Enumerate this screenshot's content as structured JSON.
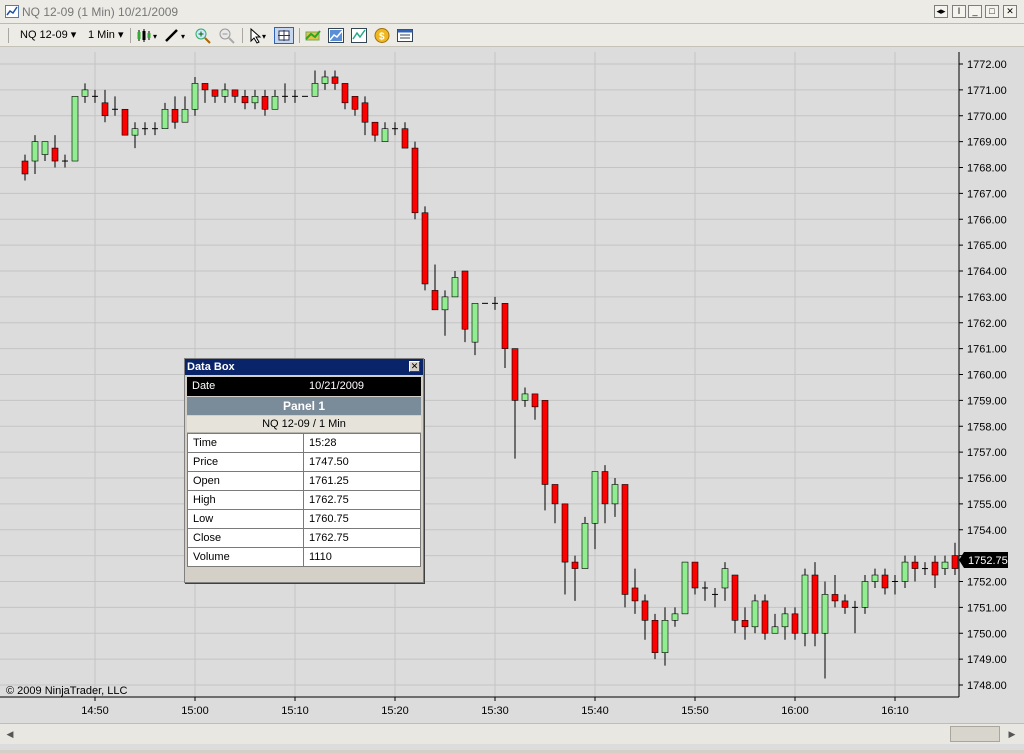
{
  "window": {
    "title": "NQ 12-09 (1 Min)  10/21/2009",
    "buttons": [
      "restore",
      "pin",
      "minimize",
      "maximize",
      "close"
    ]
  },
  "toolbar": {
    "instrument": "NQ 12-09",
    "interval": "1 Min",
    "icons": [
      "bar-type-icon",
      "drawing-tool-icon",
      "zoom-in-icon",
      "zoom-out-icon",
      "pointer-icon",
      "crosshair-icon",
      "chart-properties-icon",
      "indicator-icon",
      "strategy-icon",
      "order-icon",
      "data-box-icon"
    ]
  },
  "chart": {
    "copyright": "© 2009 NinjaTrader, LLC",
    "last_price_label": "1752.75",
    "colors": {
      "up": "#90ee90",
      "down": "#ff0000",
      "background": "#dcdcdc",
      "grid": "#c4c4c4"
    }
  },
  "chart_data": {
    "type": "candlestick",
    "title": "",
    "xlabel": "",
    "ylabel": "",
    "ylim": [
      1747.8,
      1772.4
    ],
    "x_ticks": [
      "14:50",
      "15:00",
      "15:10",
      "15:20",
      "15:30",
      "15:40",
      "15:50",
      "16:00",
      "16:10"
    ],
    "y_ticks": [
      "1772.00",
      "1771.00",
      "1770.00",
      "1769.00",
      "1768.00",
      "1767.00",
      "1766.00",
      "1765.00",
      "1764.00",
      "1763.00",
      "1762.00",
      "1761.00",
      "1760.00",
      "1759.00",
      "1758.00",
      "1757.00",
      "1756.00",
      "1755.00",
      "1754.00",
      "1753.00",
      "1752.00",
      "1751.00",
      "1750.00",
      "1749.00",
      "1748.00"
    ],
    "candles": [
      [
        "14:43",
        1768.25,
        1767.75,
        1768.5,
        1767.5
      ],
      [
        "14:44",
        1768.25,
        1769.0,
        1769.25,
        1767.75
      ],
      [
        "14:45",
        1768.5,
        1769.0,
        1769.0,
        1768.25
      ],
      [
        "14:46",
        1768.75,
        1768.25,
        1769.25,
        1768.0
      ],
      [
        "14:47",
        1768.25,
        1768.25,
        1768.5,
        1768.0
      ],
      [
        "14:48",
        1768.25,
        1770.75,
        1770.75,
        1768.25
      ],
      [
        "14:49",
        1770.75,
        1771.0,
        1771.25,
        1770.5
      ],
      [
        "14:50",
        1770.75,
        1770.75,
        1771.0,
        1770.5
      ],
      [
        "14:51",
        1770.5,
        1770.0,
        1771.0,
        1769.75
      ],
      [
        "14:52",
        1770.25,
        1770.25,
        1770.75,
        1770.0
      ],
      [
        "14:53",
        1770.25,
        1769.25,
        1770.25,
        1769.25
      ],
      [
        "14:54",
        1769.25,
        1769.5,
        1769.75,
        1768.75
      ],
      [
        "14:55",
        1769.5,
        1769.5,
        1769.75,
        1769.25
      ],
      [
        "14:56",
        1769.5,
        1769.5,
        1769.75,
        1769.25
      ],
      [
        "14:57",
        1769.5,
        1770.25,
        1770.5,
        1769.5
      ],
      [
        "14:58",
        1770.25,
        1769.75,
        1770.75,
        1769.5
      ],
      [
        "14:59",
        1769.75,
        1770.25,
        1770.75,
        1769.75
      ],
      [
        "15:00",
        1770.25,
        1771.25,
        1771.5,
        1770.0
      ],
      [
        "15:01",
        1771.25,
        1771.0,
        1771.25,
        1770.5
      ],
      [
        "15:02",
        1771.0,
        1770.75,
        1771.0,
        1770.5
      ],
      [
        "15:03",
        1770.75,
        1771.0,
        1771.25,
        1770.5
      ],
      [
        "15:04",
        1771.0,
        1770.75,
        1771.0,
        1770.5
      ],
      [
        "15:05",
        1770.75,
        1770.5,
        1771.0,
        1770.25
      ],
      [
        "15:06",
        1770.5,
        1770.75,
        1771.0,
        1770.25
      ],
      [
        "15:07",
        1770.75,
        1770.25,
        1771.0,
        1770.0
      ],
      [
        "15:08",
        1770.25,
        1770.75,
        1771.0,
        1770.25
      ],
      [
        "15:09",
        1770.75,
        1770.75,
        1771.25,
        1770.5
      ],
      [
        "15:10",
        1770.75,
        1770.75,
        1771.0,
        1770.5
      ],
      [
        "15:11",
        1770.75,
        1770.75,
        1770.75,
        1770.75
      ],
      [
        "15:12",
        1770.75,
        1771.25,
        1771.75,
        1770.75
      ],
      [
        "15:13",
        1771.25,
        1771.5,
        1771.75,
        1771.0
      ],
      [
        "15:14",
        1771.5,
        1771.25,
        1771.75,
        1771.0
      ],
      [
        "15:15",
        1771.25,
        1770.5,
        1771.25,
        1770.25
      ],
      [
        "15:16",
        1770.75,
        1770.25,
        1770.75,
        1770.0
      ],
      [
        "15:17",
        1770.5,
        1769.75,
        1770.75,
        1769.25
      ],
      [
        "15:18",
        1769.75,
        1769.25,
        1769.75,
        1769.0
      ],
      [
        "15:19",
        1769.0,
        1769.5,
        1769.75,
        1769.0
      ],
      [
        "15:20",
        1769.5,
        1769.5,
        1769.75,
        1769.25
      ],
      [
        "15:21",
        1769.5,
        1768.75,
        1769.75,
        1768.75
      ],
      [
        "15:22",
        1768.75,
        1766.25,
        1769.0,
        1766.0
      ],
      [
        "15:23",
        1766.25,
        1763.5,
        1766.5,
        1763.25
      ],
      [
        "15:24",
        1763.25,
        1762.5,
        1764.25,
        1762.5
      ],
      [
        "15:25",
        1762.5,
        1763.0,
        1763.25,
        1761.5
      ],
      [
        "15:26",
        1763.0,
        1763.75,
        1764.0,
        1763.0
      ],
      [
        "15:27",
        1764.0,
        1761.75,
        1764.0,
        1761.25
      ],
      [
        "15:28",
        1761.25,
        1762.75,
        1762.75,
        1760.75
      ],
      [
        "15:29",
        1762.75,
        1762.75,
        1762.75,
        1762.75
      ],
      [
        "15:30",
        1762.75,
        1762.75,
        1763.0,
        1762.5
      ],
      [
        "15:31",
        1762.75,
        1761.0,
        1762.75,
        1760.25
      ],
      [
        "15:32",
        1761.0,
        1759.0,
        1761.0,
        1756.75
      ],
      [
        "15:33",
        1759.0,
        1759.25,
        1759.5,
        1758.75
      ],
      [
        "15:34",
        1759.25,
        1758.75,
        1759.25,
        1758.25
      ],
      [
        "15:35",
        1759.0,
        1755.75,
        1759.0,
        1754.75
      ],
      [
        "15:36",
        1755.75,
        1755.0,
        1755.75,
        1754.25
      ],
      [
        "15:37",
        1755.0,
        1752.75,
        1755.0,
        1751.5
      ],
      [
        "15:38",
        1752.75,
        1752.5,
        1753.0,
        1751.25
      ],
      [
        "15:39",
        1752.5,
        1754.25,
        1754.5,
        1752.5
      ],
      [
        "15:40",
        1754.25,
        1756.25,
        1756.25,
        1753.25
      ],
      [
        "15:41",
        1756.25,
        1755.0,
        1756.5,
        1754.25
      ],
      [
        "15:42",
        1755.0,
        1755.75,
        1756.0,
        1754.5
      ],
      [
        "15:43",
        1755.75,
        1751.5,
        1755.75,
        1751.0
      ],
      [
        "15:44",
        1751.75,
        1751.25,
        1752.5,
        1750.75
      ],
      [
        "15:45",
        1751.25,
        1750.5,
        1751.5,
        1749.75
      ],
      [
        "15:46",
        1750.5,
        1749.25,
        1750.75,
        1749.0
      ],
      [
        "15:47",
        1749.25,
        1750.5,
        1751.0,
        1748.75
      ],
      [
        "15:48",
        1750.5,
        1750.75,
        1751.0,
        1750.25
      ],
      [
        "15:49",
        1750.75,
        1752.75,
        1752.75,
        1750.75
      ],
      [
        "15:50",
        1752.75,
        1751.75,
        1752.75,
        1751.5
      ],
      [
        "15:51",
        1751.75,
        1751.75,
        1752.0,
        1751.25
      ],
      [
        "15:52",
        1751.5,
        1751.5,
        1751.75,
        1751.0
      ],
      [
        "15:53",
        1751.75,
        1752.5,
        1752.75,
        1751.25
      ],
      [
        "15:54",
        1752.25,
        1750.5,
        1752.25,
        1750.0
      ],
      [
        "15:55",
        1750.5,
        1750.25,
        1751.0,
        1749.75
      ],
      [
        "15:56",
        1750.25,
        1751.25,
        1751.5,
        1750.0
      ],
      [
        "15:57",
        1751.25,
        1750.0,
        1751.5,
        1749.75
      ],
      [
        "15:58",
        1750.0,
        1750.25,
        1750.75,
        1750.0
      ],
      [
        "15:59",
        1750.25,
        1750.75,
        1751.0,
        1749.75
      ],
      [
        "16:00",
        1750.75,
        1750.0,
        1751.0,
        1749.75
      ],
      [
        "16:01",
        1750.0,
        1752.25,
        1752.5,
        1749.5
      ],
      [
        "16:02",
        1752.25,
        1750.0,
        1752.75,
        1749.5
      ],
      [
        "16:03",
        1750.0,
        1751.5,
        1752.0,
        1748.25
      ],
      [
        "16:04",
        1751.5,
        1751.25,
        1752.25,
        1751.0
      ],
      [
        "16:05",
        1751.25,
        1751.0,
        1751.5,
        1750.75
      ],
      [
        "16:06",
        1751.0,
        1751.0,
        1751.25,
        1750.0
      ],
      [
        "16:07",
        1751.0,
        1752.0,
        1752.25,
        1750.75
      ],
      [
        "16:08",
        1752.0,
        1752.25,
        1752.5,
        1751.75
      ],
      [
        "16:09",
        1752.25,
        1751.75,
        1752.5,
        1751.5
      ],
      [
        "16:10",
        1752.0,
        1752.0,
        1752.25,
        1751.5
      ],
      [
        "16:11",
        1752.0,
        1752.75,
        1753.0,
        1751.75
      ],
      [
        "16:12",
        1752.75,
        1752.5,
        1753.0,
        1752.0
      ],
      [
        "16:13",
        1752.5,
        1752.5,
        1752.75,
        1752.25
      ],
      [
        "16:14",
        1752.75,
        1752.25,
        1753.0,
        1751.75
      ],
      [
        "16:15",
        1752.5,
        1752.75,
        1753.0,
        1752.25
      ],
      [
        "16:16",
        1753.0,
        1752.5,
        1753.5,
        1752.25
      ]
    ]
  },
  "databox": {
    "title": "Data Box",
    "date_label": "Date",
    "date_value": "10/21/2009",
    "panel": "Panel 1",
    "series": "NQ 12-09 / 1 Min",
    "rows": [
      {
        "label": "Time",
        "value": "15:28"
      },
      {
        "label": "Price",
        "value": "1747.50"
      },
      {
        "label": "Open",
        "value": "1761.25"
      },
      {
        "label": "High",
        "value": "1762.75"
      },
      {
        "label": "Low",
        "value": "1760.75"
      },
      {
        "label": "Close",
        "value": "1762.75"
      },
      {
        "label": "Volume",
        "value": "1110"
      }
    ]
  }
}
